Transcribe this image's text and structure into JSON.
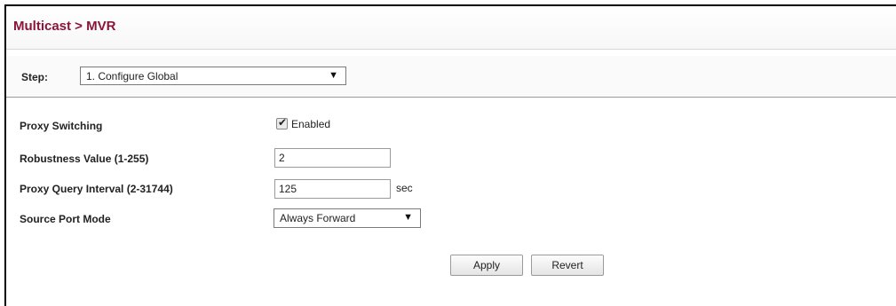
{
  "breadcrumb": "Multicast > MVR",
  "step": {
    "label": "Step:",
    "selected": "1. Configure Global",
    "arrow": "▼"
  },
  "fields": {
    "proxy_switching": {
      "label": "Proxy Switching",
      "checkbox_label": "Enabled",
      "checked": true
    },
    "robustness": {
      "label": "Robustness Value (1-255)",
      "value": "2"
    },
    "query_interval": {
      "label": "Proxy Query Interval (2-31744)",
      "value": "125",
      "unit": "sec"
    },
    "source_port_mode": {
      "label": "Source Port Mode",
      "selected": "Always Forward",
      "arrow": "▼"
    }
  },
  "buttons": {
    "apply": "Apply",
    "revert": "Revert"
  }
}
